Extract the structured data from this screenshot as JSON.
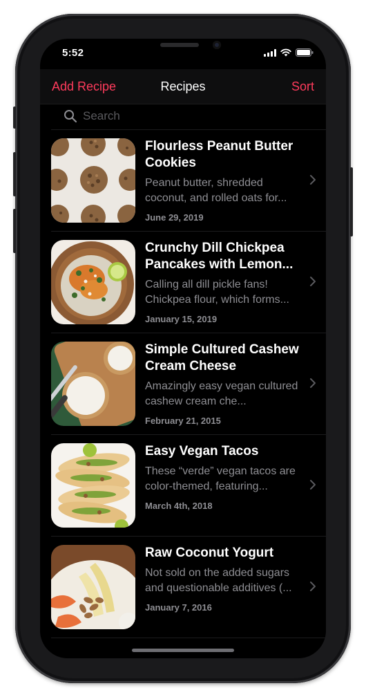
{
  "status_bar": {
    "time": "5:52",
    "icons": [
      "signal-icon",
      "wifi-icon",
      "battery-icon"
    ]
  },
  "nav": {
    "left_label": "Add Recipe",
    "title": "Recipes",
    "right_label": "Sort",
    "accent_color": "#ff3b5c"
  },
  "search": {
    "placeholder": "Search",
    "value": ""
  },
  "recipes": [
    {
      "title": "Flourless Peanut Butter Cookies",
      "description": "Peanut butter, shredded coconut, and rolled oats for...",
      "date": "June 29, 2019"
    },
    {
      "title": "Crunchy Dill Chickpea Pancakes with Lemon...",
      "description": "Calling all dill pickle fans! Chickpea flour, which forms...",
      "date": "January 15, 2019"
    },
    {
      "title": "Simple Cultured Cashew Cream Cheese",
      "description": "Amazingly easy vegan cultured cashew cream che...",
      "date": "February 21, 2015"
    },
    {
      "title": "Easy Vegan Tacos",
      "description": "These “verde” vegan tacos are color-themed, featuring...",
      "date": "March 4th, 2018"
    },
    {
      "title": "Raw Coconut Yogurt",
      "description": "Not sold on the added sugars and questionable additives (...",
      "date": "January 7, 2016"
    }
  ]
}
